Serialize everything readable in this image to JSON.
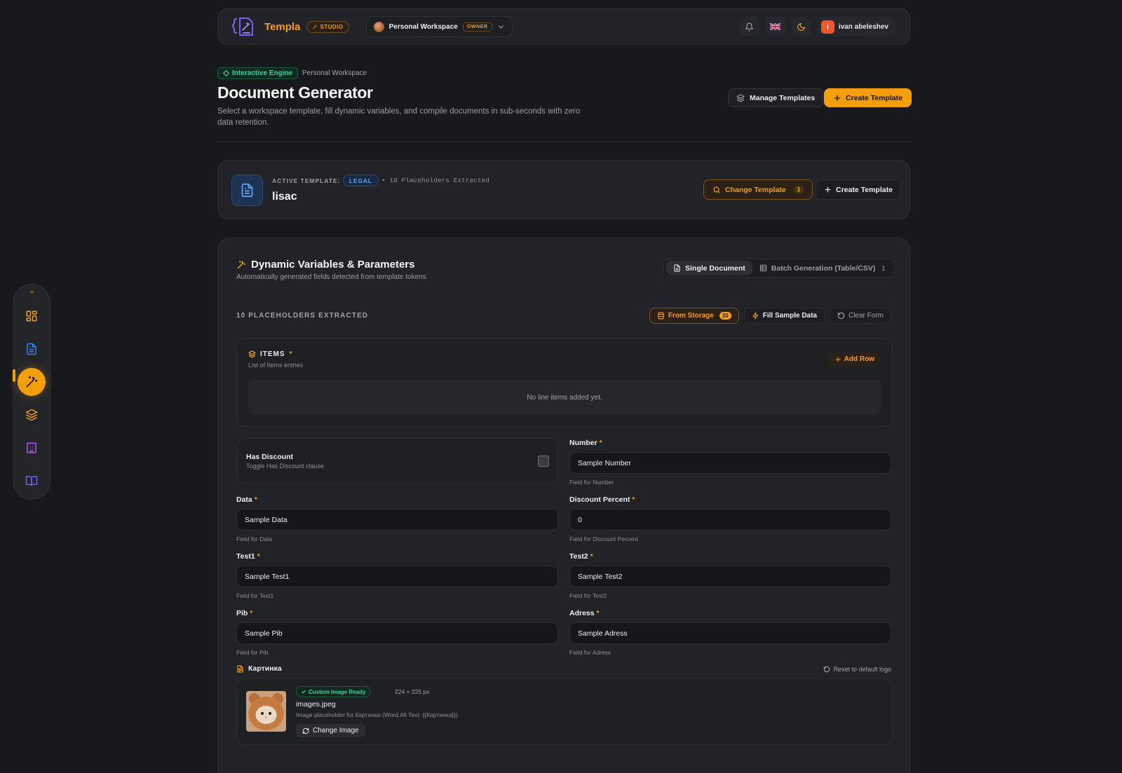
{
  "brand": {
    "name": "Templa",
    "badge": "STUDIO"
  },
  "workspace": {
    "name": "Personal Workspace",
    "role": "OWNER"
  },
  "user": {
    "initial": "i",
    "name": "ivan abeleshev"
  },
  "header": {
    "engine_badge": "Interactive Engine",
    "breadcrumb": "Personal Workspace",
    "title": "Document Generator",
    "description": "Select a workspace template, fill dynamic variables, and compile documents in sub-seconds with zero data retention.",
    "manage_templates": "Manage Templates",
    "create_template": "Create Template"
  },
  "active_template": {
    "label": "ACTIVE TEMPLATE:",
    "category": "LEGAL",
    "placeholder_info": "• 10 Placeholders Extracted",
    "name": "lisac",
    "change_button": "Change Template",
    "change_count": "1",
    "create_button": "Create Template"
  },
  "variables": {
    "title": "Dynamic Variables & Parameters",
    "subtitle": "Automatically generated fields detected from template tokens",
    "mode_single": "Single Document",
    "mode_batch": "Batch Generation (Table/CSV)",
    "mode_batch_count": "1",
    "extracted_label": "10 PLACEHOLDERS EXTRACTED",
    "from_storage": "From Storage",
    "from_storage_count": "10",
    "fill_sample": "Fill Sample Data",
    "clear_form": "Clear Form",
    "required_mark": "*",
    "items": {
      "title": "ITEMS",
      "subtitle": "List of Items entries",
      "add_row": "Add Row",
      "empty": "No line items added yet."
    },
    "discount": {
      "title": "Has Discount",
      "subtitle": "Toggle Has Discount clause",
      "checked": false
    },
    "fields": {
      "number": {
        "label": "Number",
        "value": "Sample Number",
        "help": "Field for Number"
      },
      "data": {
        "label": "Data",
        "value": "Sample Data",
        "help": "Field for Data"
      },
      "discount_percent": {
        "label": "Discount Percent",
        "value": "0",
        "help": "Field for Discount Percent"
      },
      "test1": {
        "label": "Test1",
        "value": "Sample Test1",
        "help": "Field for Test1"
      },
      "test2": {
        "label": "Test2",
        "value": "Sample Test2",
        "help": "Field for Test2"
      },
      "pib": {
        "label": "Pib",
        "value": "Sample Pib",
        "help": "Field for Pib"
      },
      "adress": {
        "label": "Adress",
        "value": "Sample Adress",
        "help": "Field for Adress"
      }
    },
    "image": {
      "label": "Картинка",
      "reset": "Reset to default logo",
      "ready_badge": "Custom Image Ready",
      "dimensions": "224 × 225 px",
      "filename": "images.jpeg",
      "description": "Image placeholder for Картинка (Word Alt Text: {{Картинка}})",
      "change_button": "Change Image"
    }
  },
  "sidebar": {
    "items": [
      {
        "icon": "dashboard-icon",
        "active": false
      },
      {
        "icon": "document-icon",
        "active": false
      },
      {
        "icon": "magic-wand-icon",
        "active": true
      },
      {
        "icon": "layers-icon",
        "active": false
      },
      {
        "icon": "building-icon",
        "active": false
      },
      {
        "icon": "book-icon",
        "active": false
      }
    ]
  },
  "colors": {
    "accent": "#f59e0b",
    "background": "#18191d",
    "card": "#212328",
    "success": "#34d399",
    "info": "#60a5fa"
  }
}
